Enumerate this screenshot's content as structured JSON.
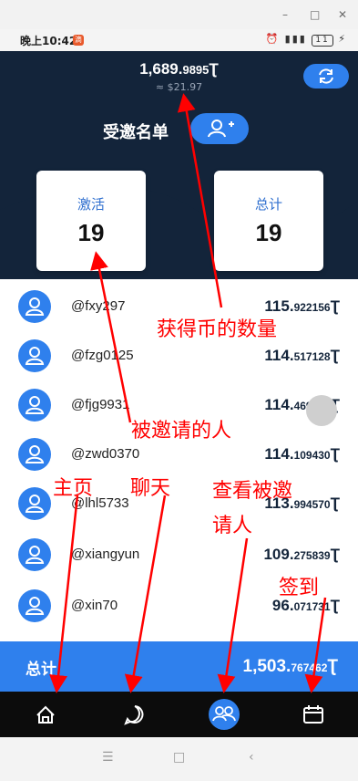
{
  "window": {
    "minimize": "–",
    "maximize": "□",
    "close": "✕"
  },
  "status_bar": {
    "time": "晚上10:42",
    "notif_badge": "滴",
    "battery": "11"
  },
  "header": {
    "balance_int": "1,689.",
    "balance_frac": "9895",
    "currency": "Ʈ",
    "usd": "≈ $21.97",
    "title": "受邀名单"
  },
  "stats": {
    "active": {
      "label": "激活",
      "value": "19"
    },
    "total": {
      "label": "总计",
      "value": "19"
    }
  },
  "invitees": [
    {
      "user": "@fxy297",
      "int": "115.",
      "frac": "922156"
    },
    {
      "user": "@fzg0125",
      "int": "114.",
      "frac": "517128"
    },
    {
      "user": "@fjg9931",
      "int": "114.",
      "frac": "469050"
    },
    {
      "user": "@zwd0370",
      "int": "114.",
      "frac": "109430"
    },
    {
      "user": "@lhl5733",
      "int": "113.",
      "frac": "994570"
    },
    {
      "user": "@xiangyun",
      "int": "109.",
      "frac": "275839"
    },
    {
      "user": "@xin70",
      "int": "96.",
      "frac": "071731"
    }
  ],
  "footer_total": {
    "label": "总计",
    "int": "1,503.",
    "frac": "767462"
  },
  "bottom_nav": [
    "home-icon",
    "chat-icon",
    "group-icon",
    "calendar-icon"
  ],
  "annotations": {
    "coins": "获得币的数量",
    "invited": "被邀请的人",
    "home": "主页",
    "chat": "聊天",
    "view_invited_line1": "查看被邀",
    "view_invited_line2": "请人",
    "checkin": "签到"
  },
  "colors": {
    "navy": "#13243a",
    "accent": "#2f80ed",
    "annotation": "#ff0000"
  }
}
